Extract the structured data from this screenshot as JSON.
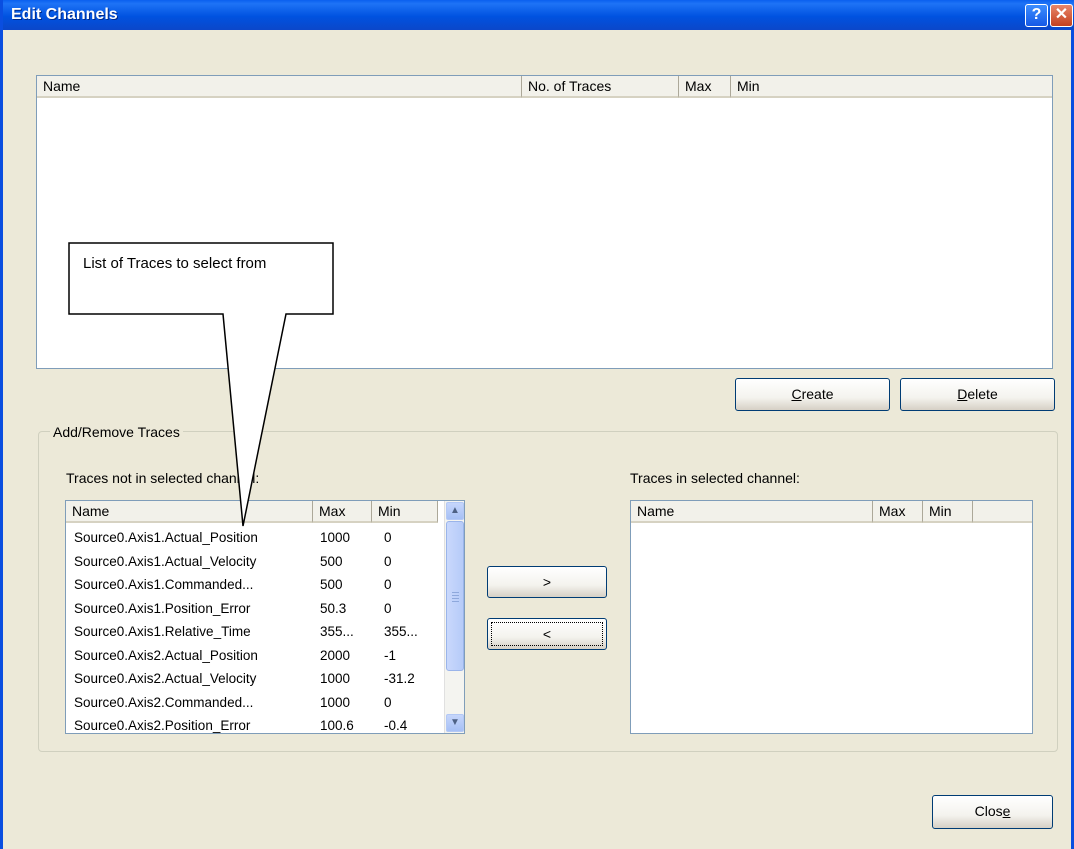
{
  "window": {
    "title": "Edit Channels"
  },
  "channels_list": {
    "columns": [
      "Name",
      "No. of Traces",
      "Max",
      "Min"
    ]
  },
  "buttons": {
    "create": {
      "mnemonic": "C",
      "rest": "reate"
    },
    "delete": {
      "mnemonic": "D",
      "rest": "elete"
    },
    "add": ">",
    "remove": "<",
    "close": {
      "pre": "Clos",
      "mnemonic": "e"
    }
  },
  "group": {
    "title": "Add/Remove Traces",
    "left_label": "Traces not in selected channel:",
    "right_label": "Traces in selected channel:"
  },
  "available_traces": {
    "columns": [
      "Name",
      "Max",
      "Min"
    ],
    "rows": [
      {
        "name": "Source0.Axis1.Actual_Position",
        "max": "1000",
        "min": "0"
      },
      {
        "name": "Source0.Axis1.Actual_Velocity",
        "max": "500",
        "min": "0"
      },
      {
        "name": "Source0.Axis1.Commanded...",
        "max": "500",
        "min": "0"
      },
      {
        "name": "Source0.Axis1.Position_Error",
        "max": "50.3",
        "min": "0"
      },
      {
        "name": "Source0.Axis1.Relative_Time",
        "max": "355...",
        "min": "355..."
      },
      {
        "name": "Source0.Axis2.Actual_Position",
        "max": "2000",
        "min": "-1"
      },
      {
        "name": "Source0.Axis2.Actual_Velocity",
        "max": "1000",
        "min": "-31.2"
      },
      {
        "name": "Source0.Axis2.Commanded...",
        "max": "1000",
        "min": "0"
      },
      {
        "name": "Source0.Axis2.Position_Error",
        "max": "100.6",
        "min": "-0.4"
      }
    ]
  },
  "selected_traces": {
    "columns": [
      "Name",
      "Max",
      "Min"
    ]
  },
  "callout": {
    "text": "List of Traces to select from"
  },
  "icons": {
    "help": "help-icon",
    "close": "close-icon",
    "scroll_up": "scroll-up-arrow-icon",
    "scroll_down": "scroll-down-arrow-icon"
  }
}
